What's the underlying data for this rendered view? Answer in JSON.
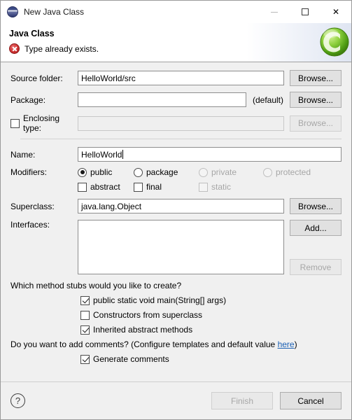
{
  "window": {
    "title": "New Java Class",
    "icon": "eclipse-globe-icon",
    "minimize_label": "",
    "maximize_label": "",
    "close_label": "✕"
  },
  "header": {
    "title": "Java Class",
    "message": "Type already exists.",
    "message_type": "error",
    "wizard_icon": "java-class-wizard-icon"
  },
  "form": {
    "source_folder": {
      "label": "Source folder:",
      "value": "HelloWorld/src",
      "browse_label": "Browse..."
    },
    "package": {
      "label": "Package:",
      "value": "",
      "default_hint": "(default)",
      "browse_label": "Browse..."
    },
    "enclosing_type": {
      "label": "Enclosing type:",
      "checked": false,
      "value": "",
      "browse_label": "Browse...",
      "enabled": false
    },
    "name": {
      "label": "Name:",
      "value": "HelloWorld"
    },
    "modifiers": {
      "label": "Modifiers:",
      "access": [
        {
          "label": "public",
          "checked": true,
          "enabled": true
        },
        {
          "label": "package",
          "checked": false,
          "enabled": true
        },
        {
          "label": "private",
          "checked": false,
          "enabled": false
        },
        {
          "label": "protected",
          "checked": false,
          "enabled": false
        }
      ],
      "flags": [
        {
          "label": "abstract",
          "checked": false,
          "enabled": true
        },
        {
          "label": "final",
          "checked": false,
          "enabled": true
        },
        {
          "label": "static",
          "checked": false,
          "enabled": false
        }
      ]
    },
    "superclass": {
      "label": "Superclass:",
      "value": "java.lang.Object",
      "browse_label": "Browse..."
    },
    "interfaces": {
      "label": "Interfaces:",
      "items": [],
      "add_label": "Add...",
      "remove_label": "Remove",
      "remove_enabled": false
    }
  },
  "stubs": {
    "question": "Which method stubs would you like to create?",
    "options": [
      {
        "label": "public static void main(String[] args)",
        "checked": true
      },
      {
        "label": "Constructors from superclass",
        "checked": false
      },
      {
        "label": "Inherited abstract methods",
        "checked": true
      }
    ]
  },
  "comments": {
    "question_prefix": "Do you want to add comments? (Configure templates and default value ",
    "link_text": "here",
    "question_suffix": ")",
    "option": {
      "label": "Generate comments",
      "checked": true
    }
  },
  "footer": {
    "help_glyph": "?",
    "finish_label": "Finish",
    "finish_enabled": false,
    "cancel_label": "Cancel"
  },
  "colors": {
    "error": "#cf3333",
    "link": "#1a5fb4",
    "accent_green": "#7ac943"
  }
}
